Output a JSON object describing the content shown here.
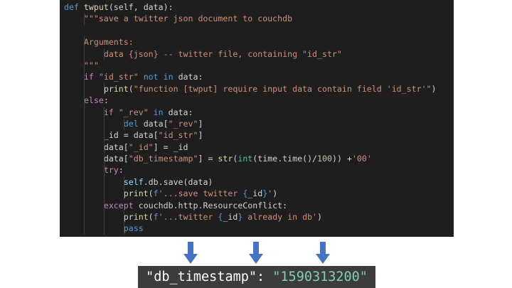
{
  "code_lines": [
    [
      [
        "kw",
        "def "
      ],
      [
        "fn",
        "twput"
      ],
      [
        "plain",
        "(self, data):"
      ]
    ],
    [
      [
        "str",
        "\"\"\"save a twitter json document to couchdb"
      ]
    ],
    [
      [
        "plain",
        ""
      ]
    ],
    [
      [
        "str",
        "Arguments:"
      ]
    ],
    [
      [
        "str",
        "data {json} -- twitter file, containing \"id_str\""
      ]
    ],
    [
      [
        "str",
        "\"\"\""
      ]
    ],
    [
      [
        "ctl",
        "if "
      ],
      [
        "str",
        "\"id_str\""
      ],
      [
        "plain",
        " "
      ],
      [
        "kw",
        "not in"
      ],
      [
        "plain",
        " data:"
      ]
    ],
    [
      [
        "fn",
        "print"
      ],
      [
        "plain",
        "("
      ],
      [
        "str",
        "\"function [twput] require input data contain field 'id_str'\""
      ],
      [
        "plain",
        ")"
      ]
    ],
    [
      [
        "ctl",
        "else"
      ],
      [
        "plain",
        ":"
      ]
    ],
    [
      [
        "ctl",
        "if "
      ],
      [
        "str",
        "\"_rev\""
      ],
      [
        "plain",
        " "
      ],
      [
        "kw",
        "in"
      ],
      [
        "plain",
        " data:"
      ]
    ],
    [
      [
        "kw",
        "del "
      ],
      [
        "plain",
        "data["
      ],
      [
        "str",
        "\"_rev\""
      ],
      [
        "plain",
        "]"
      ]
    ],
    [
      [
        "plain",
        "_id = data["
      ],
      [
        "str",
        "\"id_str\""
      ],
      [
        "plain",
        "]"
      ]
    ],
    [
      [
        "plain",
        "data["
      ],
      [
        "str",
        "\"_id\""
      ],
      [
        "plain",
        "] = _id"
      ]
    ],
    [
      [
        "plain",
        "data["
      ],
      [
        "str",
        "\"db_timestamp\""
      ],
      [
        "plain",
        "] = "
      ],
      [
        "fn",
        "str"
      ],
      [
        "plain",
        "("
      ],
      [
        "cls",
        "int"
      ],
      [
        "plain",
        "(time.time()/"
      ],
      [
        "num",
        "100"
      ],
      [
        "plain",
        ")) +"
      ],
      [
        "str",
        "'00'"
      ]
    ],
    [
      [
        "ctl",
        "try"
      ],
      [
        "plain",
        ":"
      ]
    ],
    [
      [
        "var",
        "self"
      ],
      [
        "plain",
        ".db.save(data)"
      ]
    ],
    [
      [
        "fn",
        "print"
      ],
      [
        "plain",
        "("
      ],
      [
        "kw",
        "f"
      ],
      [
        "str",
        "'...save twitter "
      ],
      [
        "kw",
        "{"
      ],
      [
        "plain",
        "_id"
      ],
      [
        "kw",
        "}"
      ],
      [
        "str",
        "'"
      ],
      [
        "plain",
        ")"
      ]
    ],
    [
      [
        "ctl",
        "except "
      ],
      [
        "plain",
        "couchdb.http.ResourceConflict:"
      ]
    ],
    [
      [
        "fn",
        "print"
      ],
      [
        "plain",
        "("
      ],
      [
        "kw",
        "f"
      ],
      [
        "str",
        "'...twitter "
      ],
      [
        "kw",
        "{"
      ],
      [
        "plain",
        "_id"
      ],
      [
        "kw",
        "}"
      ],
      [
        "str",
        " already in db'"
      ],
      [
        "plain",
        ")"
      ]
    ],
    [
      [
        "kw",
        "pass"
      ]
    ]
  ],
  "result": {
    "key": "\"db_timestamp\": ",
    "value": "\"1590313200\""
  },
  "arrow_color": "#4472c4"
}
